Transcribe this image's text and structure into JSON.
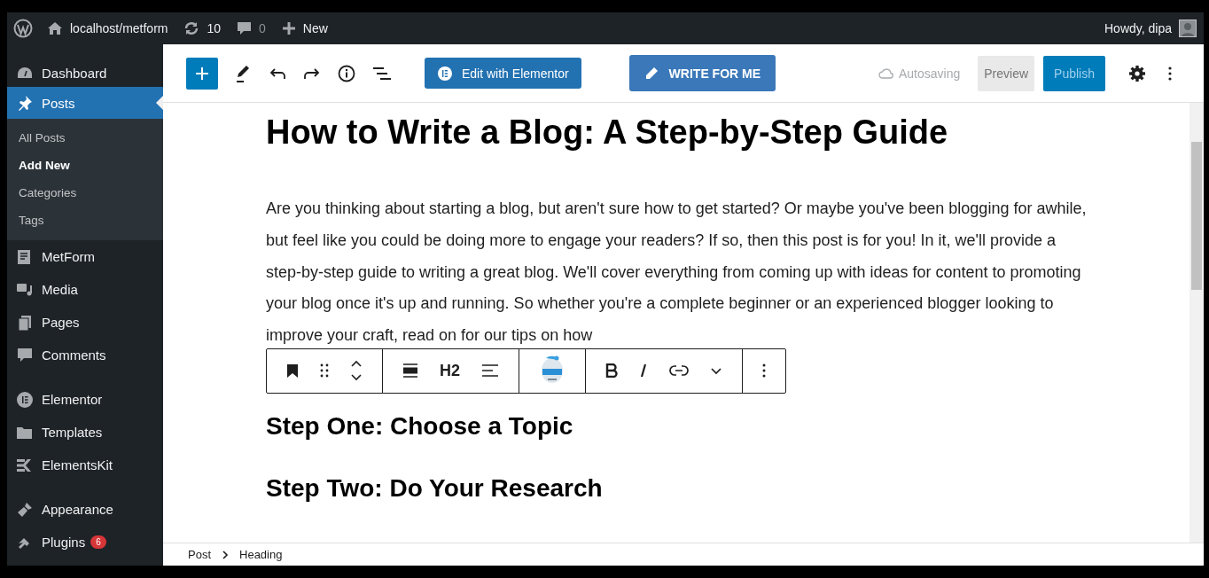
{
  "admin_bar": {
    "site": "localhost/metform",
    "updates": "10",
    "comments": "0",
    "new": "New",
    "greeting": "Howdy, dipa"
  },
  "sidebar": {
    "groups": [
      [
        {
          "label": "Dashboard",
          "selected": false
        },
        {
          "label": "Posts",
          "selected": true,
          "children": [
            {
              "label": "All Posts",
              "selected": false
            },
            {
              "label": "Add New",
              "selected": true
            },
            {
              "label": "Categories",
              "selected": false
            },
            {
              "label": "Tags",
              "selected": false
            }
          ]
        },
        {
          "label": "MetForm",
          "selected": false
        },
        {
          "label": "Media",
          "selected": false
        },
        {
          "label": "Pages",
          "selected": false
        },
        {
          "label": "Comments",
          "selected": false
        }
      ],
      [
        {
          "label": "Elementor",
          "selected": false
        },
        {
          "label": "Templates",
          "selected": false
        },
        {
          "label": "ElementsKit",
          "selected": false
        }
      ],
      [
        {
          "label": "Appearance",
          "selected": false
        },
        {
          "label": "Plugins",
          "selected": false,
          "badge": "6"
        }
      ]
    ]
  },
  "header": {
    "elementor": "Edit with Elementor",
    "write": "WRITE FOR ME",
    "status": "Autosaving",
    "preview": "Preview",
    "publish": {
      "label": "Publish",
      "disabled": true
    }
  },
  "post": {
    "title": "How to Write a Blog: A Step-by-Step Guide",
    "paragraph": "Are you thinking about starting a blog, but aren't sure how to get started? Or maybe you've been blogging for awhile, but feel like you could be doing more to engage your readers? If so, then this post is for you! In it, we'll provide a step-by-step guide to writing a great blog. We'll cover everything from coming up with ideas for content to promoting your blog once it's up and running. So whether you're a complete beginner or an experienced blogger looking to improve your craft, read on for our tips on how",
    "headings": [
      "Step One: Choose a Topic",
      "Step Two: Do Your Research"
    ]
  },
  "block_toolbar": {
    "level": "H2"
  },
  "breadcrumb": [
    "Post",
    "Heading"
  ]
}
